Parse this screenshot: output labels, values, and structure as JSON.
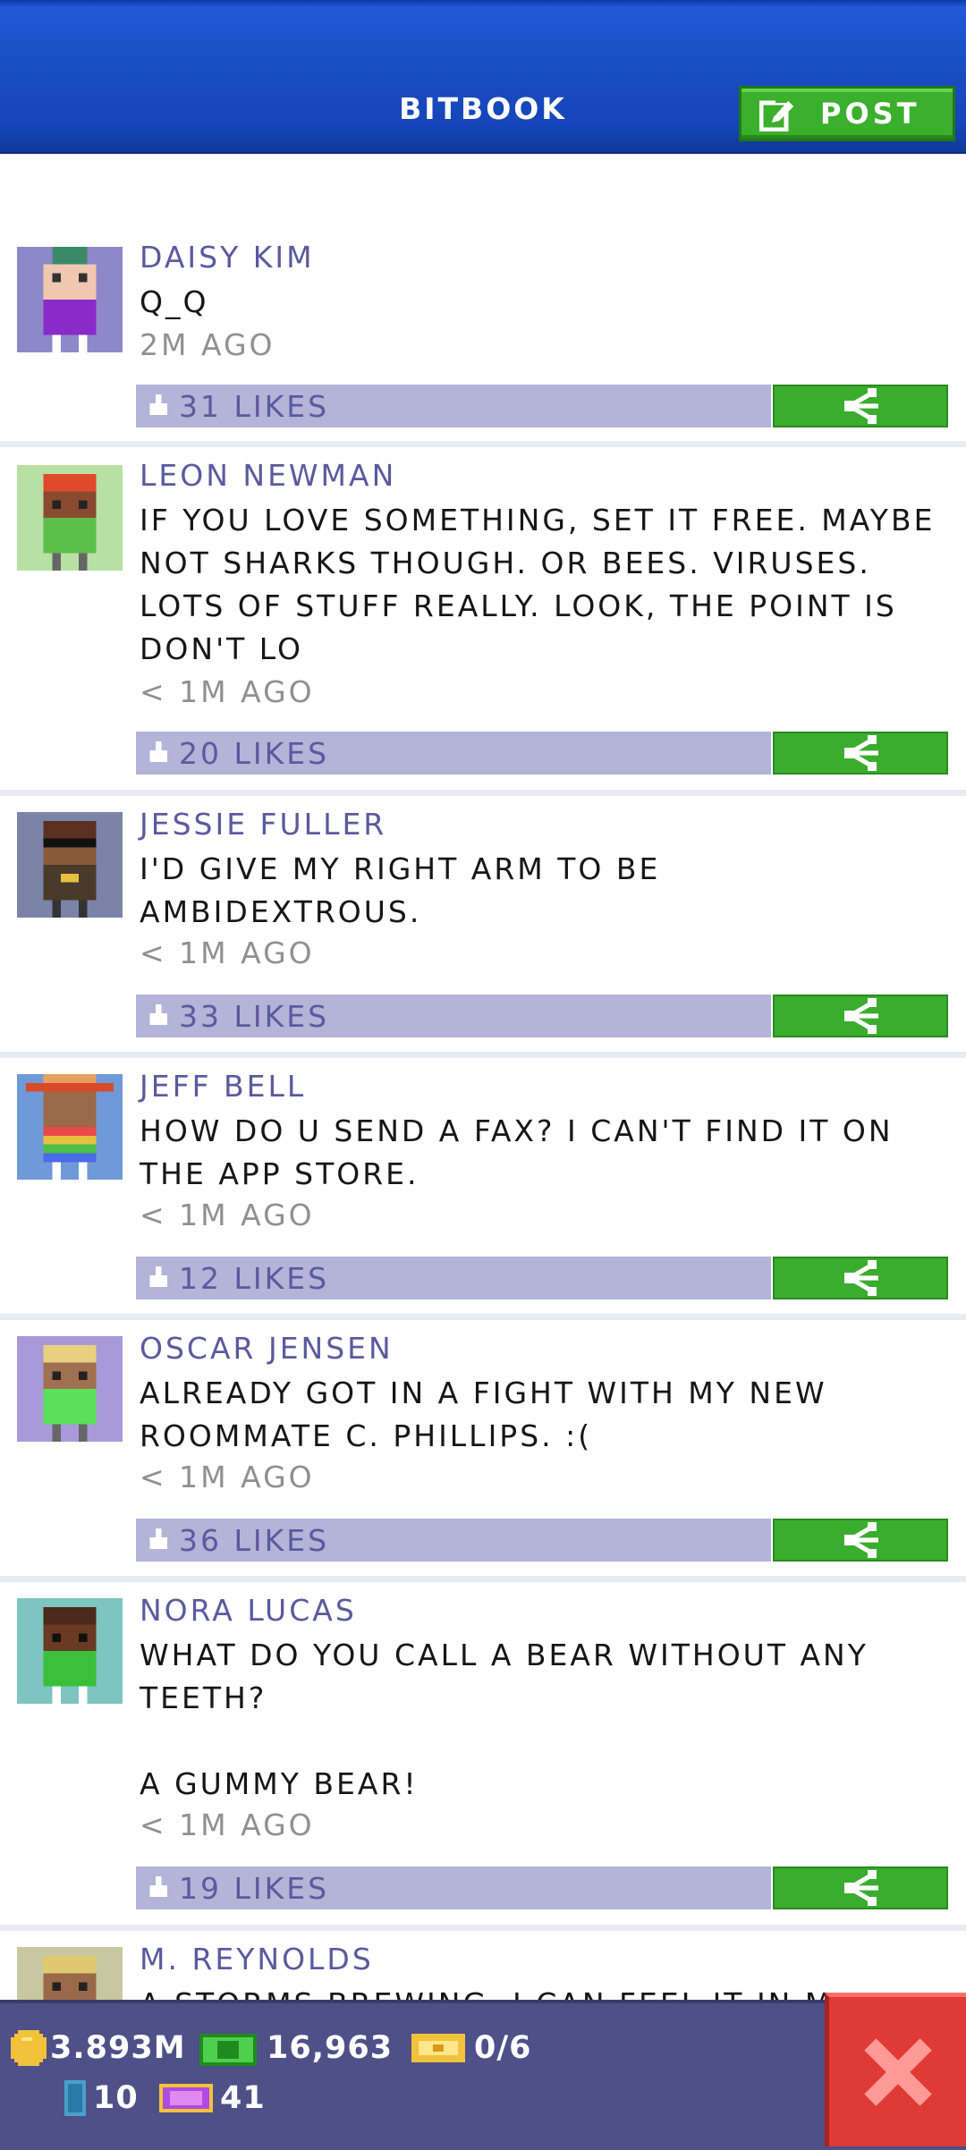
{
  "header": {
    "title": "BITBOOK",
    "post_label": "POST",
    "accent_color": "#1a4fc4",
    "post_color": "#3bb02c"
  },
  "posts": [
    {
      "name": "DAISY KIM",
      "text": "Q_Q",
      "time": "2M AGO",
      "likes": "31 LIKES",
      "avatar_bg": "#8d88c8"
    },
    {
      "name": "LEON NEWMAN",
      "text": "IF YOU LOVE SOMETHING, SET IT FREE. MAYBE NOT SHARKS THOUGH. OR BEES. VIRUSES. LOTS OF STUFF REALLY. LOOK, THE POINT IS DON'T LO",
      "time": "< 1M AGO",
      "likes": "20 LIKES",
      "avatar_bg": "#b8e0a4"
    },
    {
      "name": "JESSIE FULLER",
      "text": "I'D GIVE MY RIGHT ARM TO BE AMBIDEXTROUS.",
      "time": "< 1M AGO",
      "likes": "33 LIKES",
      "avatar_bg": "#7b84a8"
    },
    {
      "name": "JEFF BELL",
      "text": "HOW DO U SEND A FAX? I CAN'T FIND IT ON THE APP STORE.",
      "time": "< 1M AGO",
      "likes": "12 LIKES",
      "avatar_bg": "#6f9ad8"
    },
    {
      "name": "OSCAR JENSEN",
      "text": "ALREADY GOT IN A FIGHT WITH MY NEW ROOMMATE C. PHILLIPS. :(",
      "time": "< 1M AGO",
      "likes": "36 LIKES",
      "avatar_bg": "#a89ad8"
    },
    {
      "name": "NORA LUCAS",
      "text": "WHAT DO YOU CALL A BEAR WITHOUT ANY TEETH?\n\nA GUMMY BEAR!",
      "time": "< 1M AGO",
      "likes": "19 LIKES",
      "avatar_bg": "#7ec4c0"
    },
    {
      "name": "M. REYNOLDS",
      "text": "A STORMS BREWING. I CAN FEEL IT IN MY",
      "time": "",
      "likes": "",
      "avatar_bg": "#c8c8a0"
    }
  ],
  "stats": {
    "coins": "3.893M",
    "bux": "16,963",
    "tickets": "0/6",
    "residents": "10",
    "vip": "41"
  },
  "icons": {
    "edit": "edit-icon",
    "thumb": "thumbs-up-icon",
    "share": "share-icon",
    "coin": "coin-icon",
    "bux": "bux-icon",
    "ticket": "ticket-icon",
    "resident": "resident-icon",
    "vip": "vip-icon",
    "close": "close-icon"
  }
}
